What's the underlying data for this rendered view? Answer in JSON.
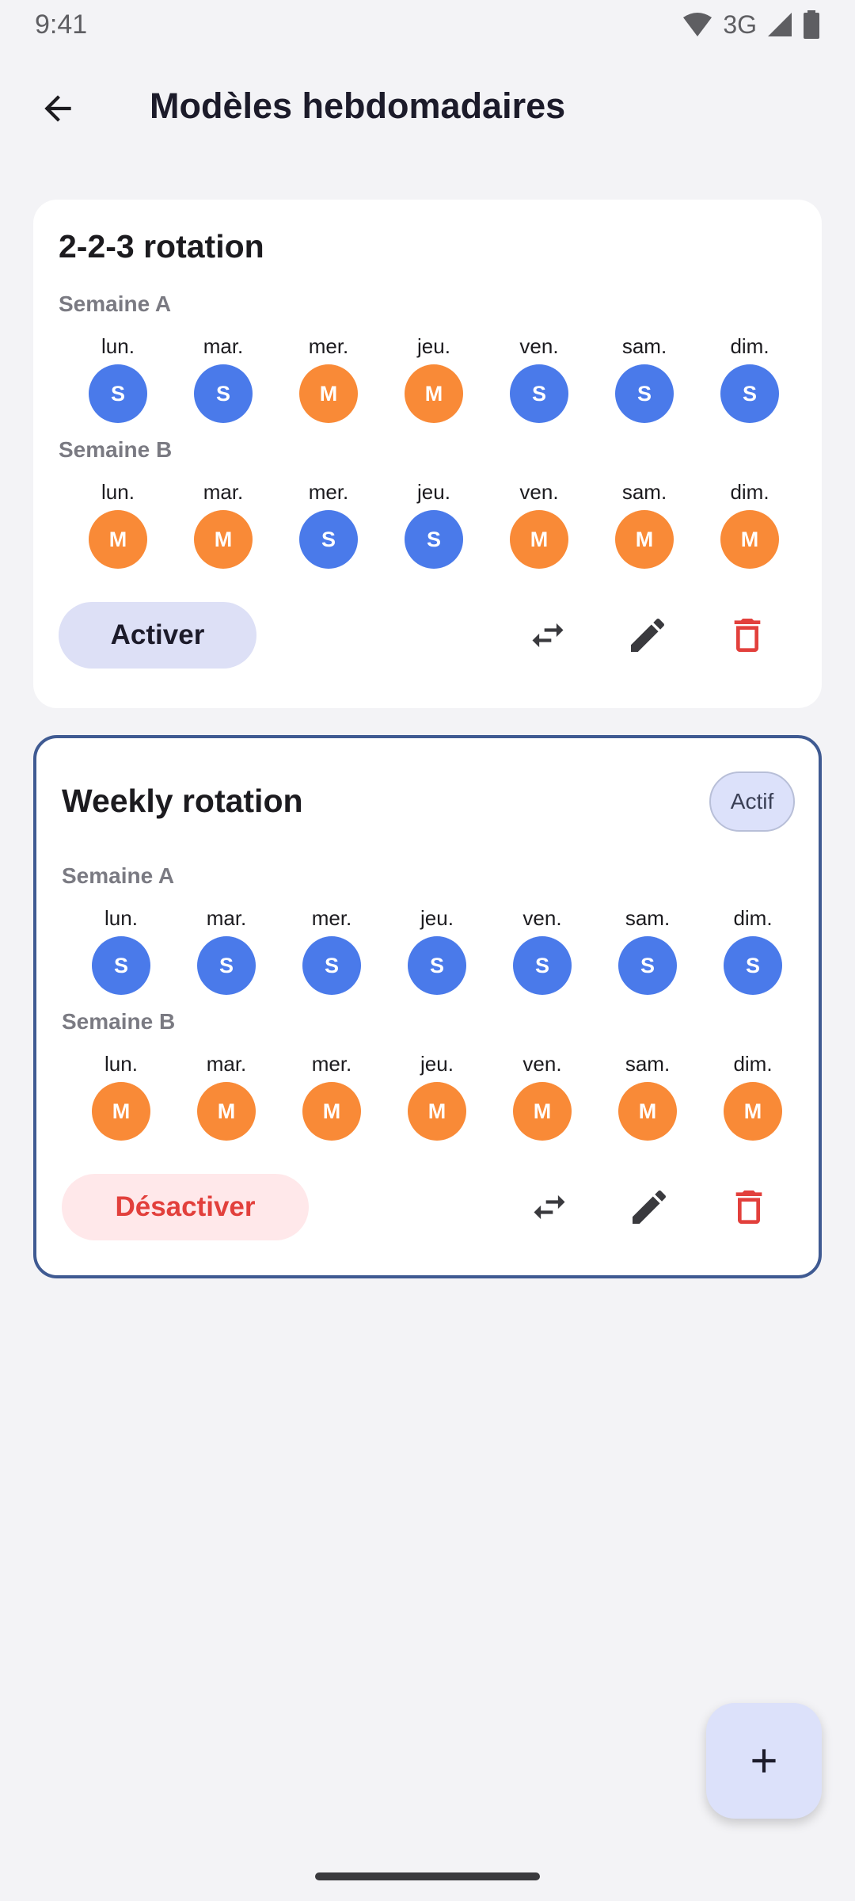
{
  "status_bar": {
    "time": "9:41",
    "network": "3G"
  },
  "app_bar": {
    "title": "Modèles hebdomadaires"
  },
  "colors": {
    "shift_S": "#4A7AEA",
    "shift_M": "#F98A37",
    "danger": "#E2403C",
    "active_border": "#3F5A92"
  },
  "templates": [
    {
      "title": "2-2-3 rotation",
      "active": false,
      "weeks": [
        {
          "label": "Semaine A",
          "days": [
            {
              "day": "lun.",
              "shift": "S"
            },
            {
              "day": "mar.",
              "shift": "S"
            },
            {
              "day": "mer.",
              "shift": "M"
            },
            {
              "day": "jeu.",
              "shift": "M"
            },
            {
              "day": "ven.",
              "shift": "S"
            },
            {
              "day": "sam.",
              "shift": "S"
            },
            {
              "day": "dim.",
              "shift": "S"
            }
          ]
        },
        {
          "label": "Semaine B",
          "days": [
            {
              "day": "lun.",
              "shift": "M"
            },
            {
              "day": "mar.",
              "shift": "M"
            },
            {
              "day": "mer.",
              "shift": "S"
            },
            {
              "day": "jeu.",
              "shift": "S"
            },
            {
              "day": "ven.",
              "shift": "M"
            },
            {
              "day": "sam.",
              "shift": "M"
            },
            {
              "day": "dim.",
              "shift": "M"
            }
          ]
        }
      ],
      "action_label": "Activer",
      "icons": [
        "swap-icon",
        "edit-icon",
        "delete-icon"
      ]
    },
    {
      "title": "Weekly rotation",
      "active": true,
      "active_badge": "Actif",
      "weeks": [
        {
          "label": "Semaine A",
          "days": [
            {
              "day": "lun.",
              "shift": "S"
            },
            {
              "day": "mar.",
              "shift": "S"
            },
            {
              "day": "mer.",
              "shift": "S"
            },
            {
              "day": "jeu.",
              "shift": "S"
            },
            {
              "day": "ven.",
              "shift": "S"
            },
            {
              "day": "sam.",
              "shift": "S"
            },
            {
              "day": "dim.",
              "shift": "S"
            }
          ]
        },
        {
          "label": "Semaine B",
          "days": [
            {
              "day": "lun.",
              "shift": "M"
            },
            {
              "day": "mar.",
              "shift": "M"
            },
            {
              "day": "mer.",
              "shift": "M"
            },
            {
              "day": "jeu.",
              "shift": "M"
            },
            {
              "day": "ven.",
              "shift": "M"
            },
            {
              "day": "sam.",
              "shift": "M"
            },
            {
              "day": "dim.",
              "shift": "M"
            }
          ]
        }
      ],
      "action_label": "Désactiver",
      "icons": [
        "swap-icon",
        "edit-icon",
        "delete-icon"
      ]
    }
  ],
  "fab": {
    "icon": "plus-icon"
  }
}
